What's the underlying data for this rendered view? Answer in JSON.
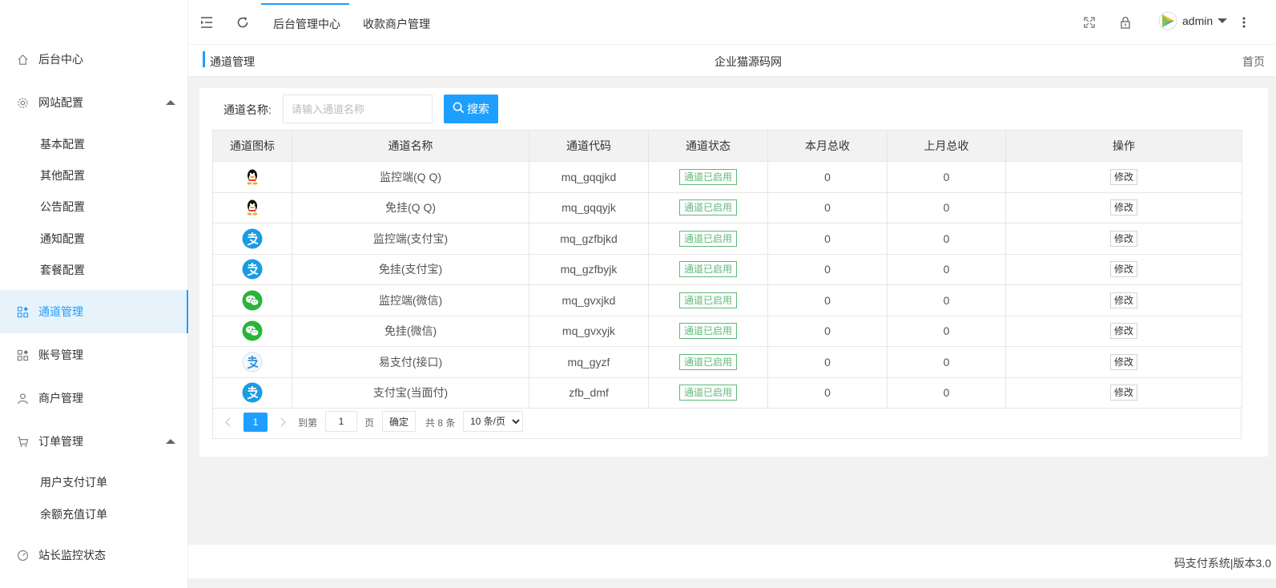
{
  "header": {
    "tabs": [
      "后台管理中心",
      "收款商户管理"
    ],
    "active_tab": 0,
    "user": "admin"
  },
  "breadcrumb": {
    "current": "通道管理",
    "site_name": "企业猫源码网",
    "home": "首页"
  },
  "sidebar": {
    "items": [
      {
        "label": "后台中心",
        "icon": "home-icon"
      },
      {
        "label": "网站配置",
        "icon": "gear-icon",
        "expanded": true,
        "children": [
          "基本配置",
          "其他配置",
          "公告配置",
          "通知配置",
          "套餐配置"
        ]
      },
      {
        "label": "通道管理",
        "icon": "apps-icon",
        "active": true
      },
      {
        "label": "账号管理",
        "icon": "apps-icon"
      },
      {
        "label": "商户管理",
        "icon": "user-icon"
      },
      {
        "label": "订单管理",
        "icon": "cart-icon",
        "expanded": true,
        "children": [
          "用户支付订单",
          "余额充值订单"
        ]
      },
      {
        "label": "站长监控状态",
        "icon": "dashboard-icon"
      }
    ]
  },
  "search": {
    "label": "通道名称:",
    "placeholder": "请输入通道名称",
    "button": "搜索"
  },
  "table": {
    "columns": [
      "通道图标",
      "通道名称",
      "通道代码",
      "通道状态",
      "本月总收",
      "上月总收",
      "操作"
    ],
    "rows": [
      {
        "icon": "qq-icon",
        "name": "监控端(Q Q)",
        "code": "mq_gqqjkd",
        "status": "通道已启用",
        "this_month": "0",
        "last_month": "0",
        "action": "修改"
      },
      {
        "icon": "qq-icon",
        "name": "免挂(Q Q)",
        "code": "mq_gqqyjk",
        "status": "通道已启用",
        "this_month": "0",
        "last_month": "0",
        "action": "修改"
      },
      {
        "icon": "alipay-icon",
        "name": "监控端(支付宝)",
        "code": "mq_gzfbjkd",
        "status": "通道已启用",
        "this_month": "0",
        "last_month": "0",
        "action": "修改"
      },
      {
        "icon": "alipay-icon",
        "name": "免挂(支付宝)",
        "code": "mq_gzfbyjk",
        "status": "通道已启用",
        "this_month": "0",
        "last_month": "0",
        "action": "修改"
      },
      {
        "icon": "wechat-icon",
        "name": "监控端(微信)",
        "code": "mq_gvxjkd",
        "status": "通道已启用",
        "this_month": "0",
        "last_month": "0",
        "action": "修改"
      },
      {
        "icon": "wechat-icon",
        "name": "免挂(微信)",
        "code": "mq_gvxyjk",
        "status": "通道已启用",
        "this_month": "0",
        "last_month": "0",
        "action": "修改"
      },
      {
        "icon": "epay-icon",
        "name": "易支付(接口)",
        "code": "mq_gyzf",
        "status": "通道已启用",
        "this_month": "0",
        "last_month": "0",
        "action": "修改"
      },
      {
        "icon": "alipay-icon",
        "name": "支付宝(当面付)",
        "code": "zfb_dmf",
        "status": "通道已启用",
        "this_month": "0",
        "last_month": "0",
        "action": "修改"
      }
    ]
  },
  "pagination": {
    "current_page": "1",
    "goto_label": "到第",
    "goto_value": "1",
    "page_unit": "页",
    "confirm": "确定",
    "total": "共 8 条",
    "page_size": "10 条/页"
  },
  "footer": {
    "text": "码支付系统|版本3.0"
  },
  "colors": {
    "accent": "#1E9FFF",
    "status_green": "#5FB878"
  }
}
